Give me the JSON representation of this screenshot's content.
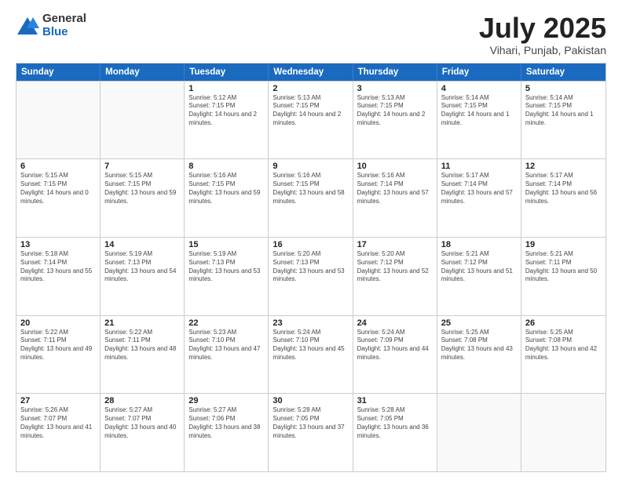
{
  "logo": {
    "general": "General",
    "blue": "Blue"
  },
  "title": "July 2025",
  "subtitle": "Vihari, Punjab, Pakistan",
  "headers": [
    "Sunday",
    "Monday",
    "Tuesday",
    "Wednesday",
    "Thursday",
    "Friday",
    "Saturday"
  ],
  "rows": [
    [
      {
        "day": "",
        "info": ""
      },
      {
        "day": "",
        "info": ""
      },
      {
        "day": "1",
        "info": "Sunrise: 5:12 AM\nSunset: 7:15 PM\nDaylight: 14 hours and 2 minutes."
      },
      {
        "day": "2",
        "info": "Sunrise: 5:13 AM\nSunset: 7:15 PM\nDaylight: 14 hours and 2 minutes."
      },
      {
        "day": "3",
        "info": "Sunrise: 5:13 AM\nSunset: 7:15 PM\nDaylight: 14 hours and 2 minutes."
      },
      {
        "day": "4",
        "info": "Sunrise: 5:14 AM\nSunset: 7:15 PM\nDaylight: 14 hours and 1 minute."
      },
      {
        "day": "5",
        "info": "Sunrise: 5:14 AM\nSunset: 7:15 PM\nDaylight: 14 hours and 1 minute."
      }
    ],
    [
      {
        "day": "6",
        "info": "Sunrise: 5:15 AM\nSunset: 7:15 PM\nDaylight: 14 hours and 0 minutes."
      },
      {
        "day": "7",
        "info": "Sunrise: 5:15 AM\nSunset: 7:15 PM\nDaylight: 13 hours and 59 minutes."
      },
      {
        "day": "8",
        "info": "Sunrise: 5:16 AM\nSunset: 7:15 PM\nDaylight: 13 hours and 59 minutes."
      },
      {
        "day": "9",
        "info": "Sunrise: 5:16 AM\nSunset: 7:15 PM\nDaylight: 13 hours and 58 minutes."
      },
      {
        "day": "10",
        "info": "Sunrise: 5:16 AM\nSunset: 7:14 PM\nDaylight: 13 hours and 57 minutes."
      },
      {
        "day": "11",
        "info": "Sunrise: 5:17 AM\nSunset: 7:14 PM\nDaylight: 13 hours and 57 minutes."
      },
      {
        "day": "12",
        "info": "Sunrise: 5:17 AM\nSunset: 7:14 PM\nDaylight: 13 hours and 56 minutes."
      }
    ],
    [
      {
        "day": "13",
        "info": "Sunrise: 5:18 AM\nSunset: 7:14 PM\nDaylight: 13 hours and 55 minutes."
      },
      {
        "day": "14",
        "info": "Sunrise: 5:19 AM\nSunset: 7:13 PM\nDaylight: 13 hours and 54 minutes."
      },
      {
        "day": "15",
        "info": "Sunrise: 5:19 AM\nSunset: 7:13 PM\nDaylight: 13 hours and 53 minutes."
      },
      {
        "day": "16",
        "info": "Sunrise: 5:20 AM\nSunset: 7:13 PM\nDaylight: 13 hours and 53 minutes."
      },
      {
        "day": "17",
        "info": "Sunrise: 5:20 AM\nSunset: 7:12 PM\nDaylight: 13 hours and 52 minutes."
      },
      {
        "day": "18",
        "info": "Sunrise: 5:21 AM\nSunset: 7:12 PM\nDaylight: 13 hours and 51 minutes."
      },
      {
        "day": "19",
        "info": "Sunrise: 5:21 AM\nSunset: 7:11 PM\nDaylight: 13 hours and 50 minutes."
      }
    ],
    [
      {
        "day": "20",
        "info": "Sunrise: 5:22 AM\nSunset: 7:11 PM\nDaylight: 13 hours and 49 minutes."
      },
      {
        "day": "21",
        "info": "Sunrise: 5:22 AM\nSunset: 7:11 PM\nDaylight: 13 hours and 48 minutes."
      },
      {
        "day": "22",
        "info": "Sunrise: 5:23 AM\nSunset: 7:10 PM\nDaylight: 13 hours and 47 minutes."
      },
      {
        "day": "23",
        "info": "Sunrise: 5:24 AM\nSunset: 7:10 PM\nDaylight: 13 hours and 45 minutes."
      },
      {
        "day": "24",
        "info": "Sunrise: 5:24 AM\nSunset: 7:09 PM\nDaylight: 13 hours and 44 minutes."
      },
      {
        "day": "25",
        "info": "Sunrise: 5:25 AM\nSunset: 7:08 PM\nDaylight: 13 hours and 43 minutes."
      },
      {
        "day": "26",
        "info": "Sunrise: 5:25 AM\nSunset: 7:08 PM\nDaylight: 13 hours and 42 minutes."
      }
    ],
    [
      {
        "day": "27",
        "info": "Sunrise: 5:26 AM\nSunset: 7:07 PM\nDaylight: 13 hours and 41 minutes."
      },
      {
        "day": "28",
        "info": "Sunrise: 5:27 AM\nSunset: 7:07 PM\nDaylight: 13 hours and 40 minutes."
      },
      {
        "day": "29",
        "info": "Sunrise: 5:27 AM\nSunset: 7:06 PM\nDaylight: 13 hours and 38 minutes."
      },
      {
        "day": "30",
        "info": "Sunrise: 5:28 AM\nSunset: 7:05 PM\nDaylight: 13 hours and 37 minutes."
      },
      {
        "day": "31",
        "info": "Sunrise: 5:28 AM\nSunset: 7:05 PM\nDaylight: 13 hours and 36 minutes."
      },
      {
        "day": "",
        "info": ""
      },
      {
        "day": "",
        "info": ""
      }
    ]
  ]
}
